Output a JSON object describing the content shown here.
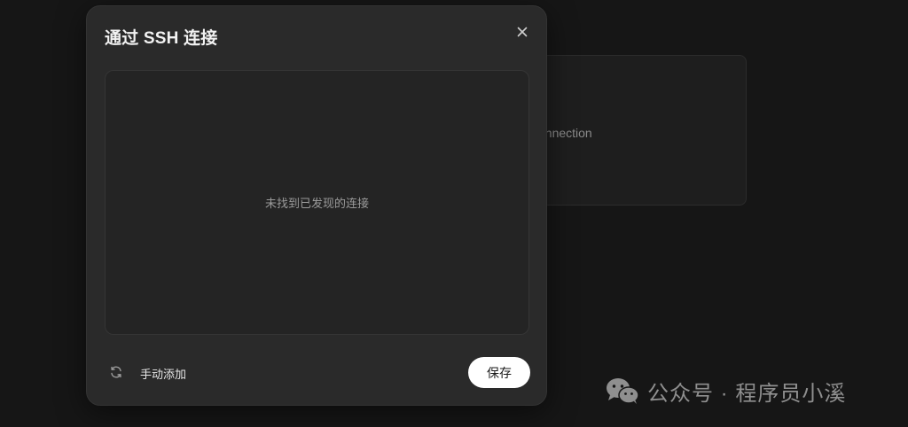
{
  "background_card": {
    "text": "onnection"
  },
  "modal": {
    "title": "通过 SSH 连接",
    "close_icon": "close-icon",
    "empty_state": "未找到已发现的连接",
    "refresh_icon": "refresh-icon",
    "manual_add_label": "手动添加",
    "save_label": "保存"
  },
  "watermark": {
    "icon": "wechat-icon",
    "text": "公众号 · 程序员小溪"
  },
  "colors": {
    "page_bg": "#161616",
    "modal_bg": "#2a2a2a",
    "list_bg": "#242424",
    "save_button_bg": "#ffffff"
  }
}
